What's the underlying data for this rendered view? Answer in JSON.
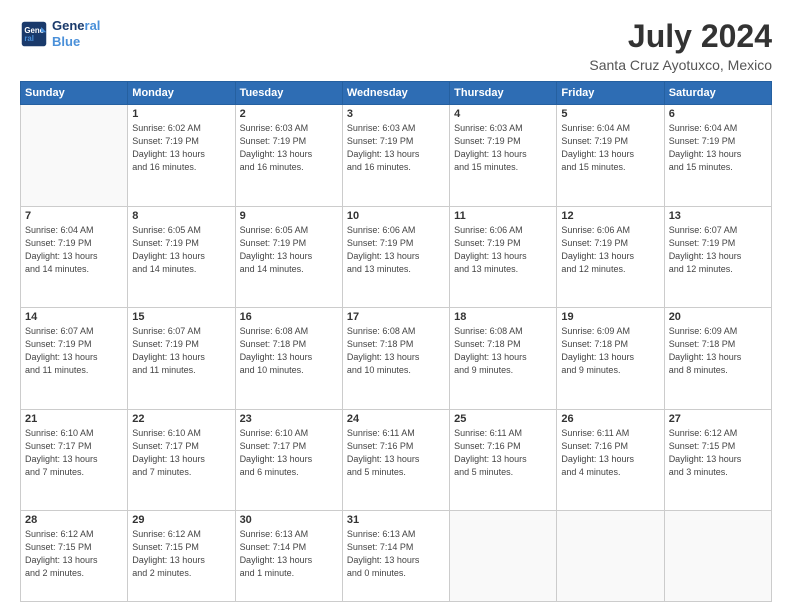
{
  "header": {
    "logo_line1": "General",
    "logo_line2": "Blue",
    "title": "July 2024",
    "subtitle": "Santa Cruz Ayotuxco, Mexico"
  },
  "days_of_week": [
    "Sunday",
    "Monday",
    "Tuesday",
    "Wednesday",
    "Thursday",
    "Friday",
    "Saturday"
  ],
  "weeks": [
    [
      {
        "day": "",
        "info": ""
      },
      {
        "day": "1",
        "info": "Sunrise: 6:02 AM\nSunset: 7:19 PM\nDaylight: 13 hours\nand 16 minutes."
      },
      {
        "day": "2",
        "info": "Sunrise: 6:03 AM\nSunset: 7:19 PM\nDaylight: 13 hours\nand 16 minutes."
      },
      {
        "day": "3",
        "info": "Sunrise: 6:03 AM\nSunset: 7:19 PM\nDaylight: 13 hours\nand 16 minutes."
      },
      {
        "day": "4",
        "info": "Sunrise: 6:03 AM\nSunset: 7:19 PM\nDaylight: 13 hours\nand 15 minutes."
      },
      {
        "day": "5",
        "info": "Sunrise: 6:04 AM\nSunset: 7:19 PM\nDaylight: 13 hours\nand 15 minutes."
      },
      {
        "day": "6",
        "info": "Sunrise: 6:04 AM\nSunset: 7:19 PM\nDaylight: 13 hours\nand 15 minutes."
      }
    ],
    [
      {
        "day": "7",
        "info": "Sunrise: 6:04 AM\nSunset: 7:19 PM\nDaylight: 13 hours\nand 14 minutes."
      },
      {
        "day": "8",
        "info": "Sunrise: 6:05 AM\nSunset: 7:19 PM\nDaylight: 13 hours\nand 14 minutes."
      },
      {
        "day": "9",
        "info": "Sunrise: 6:05 AM\nSunset: 7:19 PM\nDaylight: 13 hours\nand 14 minutes."
      },
      {
        "day": "10",
        "info": "Sunrise: 6:06 AM\nSunset: 7:19 PM\nDaylight: 13 hours\nand 13 minutes."
      },
      {
        "day": "11",
        "info": "Sunrise: 6:06 AM\nSunset: 7:19 PM\nDaylight: 13 hours\nand 13 minutes."
      },
      {
        "day": "12",
        "info": "Sunrise: 6:06 AM\nSunset: 7:19 PM\nDaylight: 13 hours\nand 12 minutes."
      },
      {
        "day": "13",
        "info": "Sunrise: 6:07 AM\nSunset: 7:19 PM\nDaylight: 13 hours\nand 12 minutes."
      }
    ],
    [
      {
        "day": "14",
        "info": "Sunrise: 6:07 AM\nSunset: 7:19 PM\nDaylight: 13 hours\nand 11 minutes."
      },
      {
        "day": "15",
        "info": "Sunrise: 6:07 AM\nSunset: 7:19 PM\nDaylight: 13 hours\nand 11 minutes."
      },
      {
        "day": "16",
        "info": "Sunrise: 6:08 AM\nSunset: 7:18 PM\nDaylight: 13 hours\nand 10 minutes."
      },
      {
        "day": "17",
        "info": "Sunrise: 6:08 AM\nSunset: 7:18 PM\nDaylight: 13 hours\nand 10 minutes."
      },
      {
        "day": "18",
        "info": "Sunrise: 6:08 AM\nSunset: 7:18 PM\nDaylight: 13 hours\nand 9 minutes."
      },
      {
        "day": "19",
        "info": "Sunrise: 6:09 AM\nSunset: 7:18 PM\nDaylight: 13 hours\nand 9 minutes."
      },
      {
        "day": "20",
        "info": "Sunrise: 6:09 AM\nSunset: 7:18 PM\nDaylight: 13 hours\nand 8 minutes."
      }
    ],
    [
      {
        "day": "21",
        "info": "Sunrise: 6:10 AM\nSunset: 7:17 PM\nDaylight: 13 hours\nand 7 minutes."
      },
      {
        "day": "22",
        "info": "Sunrise: 6:10 AM\nSunset: 7:17 PM\nDaylight: 13 hours\nand 7 minutes."
      },
      {
        "day": "23",
        "info": "Sunrise: 6:10 AM\nSunset: 7:17 PM\nDaylight: 13 hours\nand 6 minutes."
      },
      {
        "day": "24",
        "info": "Sunrise: 6:11 AM\nSunset: 7:16 PM\nDaylight: 13 hours\nand 5 minutes."
      },
      {
        "day": "25",
        "info": "Sunrise: 6:11 AM\nSunset: 7:16 PM\nDaylight: 13 hours\nand 5 minutes."
      },
      {
        "day": "26",
        "info": "Sunrise: 6:11 AM\nSunset: 7:16 PM\nDaylight: 13 hours\nand 4 minutes."
      },
      {
        "day": "27",
        "info": "Sunrise: 6:12 AM\nSunset: 7:15 PM\nDaylight: 13 hours\nand 3 minutes."
      }
    ],
    [
      {
        "day": "28",
        "info": "Sunrise: 6:12 AM\nSunset: 7:15 PM\nDaylight: 13 hours\nand 2 minutes."
      },
      {
        "day": "29",
        "info": "Sunrise: 6:12 AM\nSunset: 7:15 PM\nDaylight: 13 hours\nand 2 minutes."
      },
      {
        "day": "30",
        "info": "Sunrise: 6:13 AM\nSunset: 7:14 PM\nDaylight: 13 hours\nand 1 minute."
      },
      {
        "day": "31",
        "info": "Sunrise: 6:13 AM\nSunset: 7:14 PM\nDaylight: 13 hours\nand 0 minutes."
      },
      {
        "day": "",
        "info": ""
      },
      {
        "day": "",
        "info": ""
      },
      {
        "day": "",
        "info": ""
      }
    ]
  ]
}
